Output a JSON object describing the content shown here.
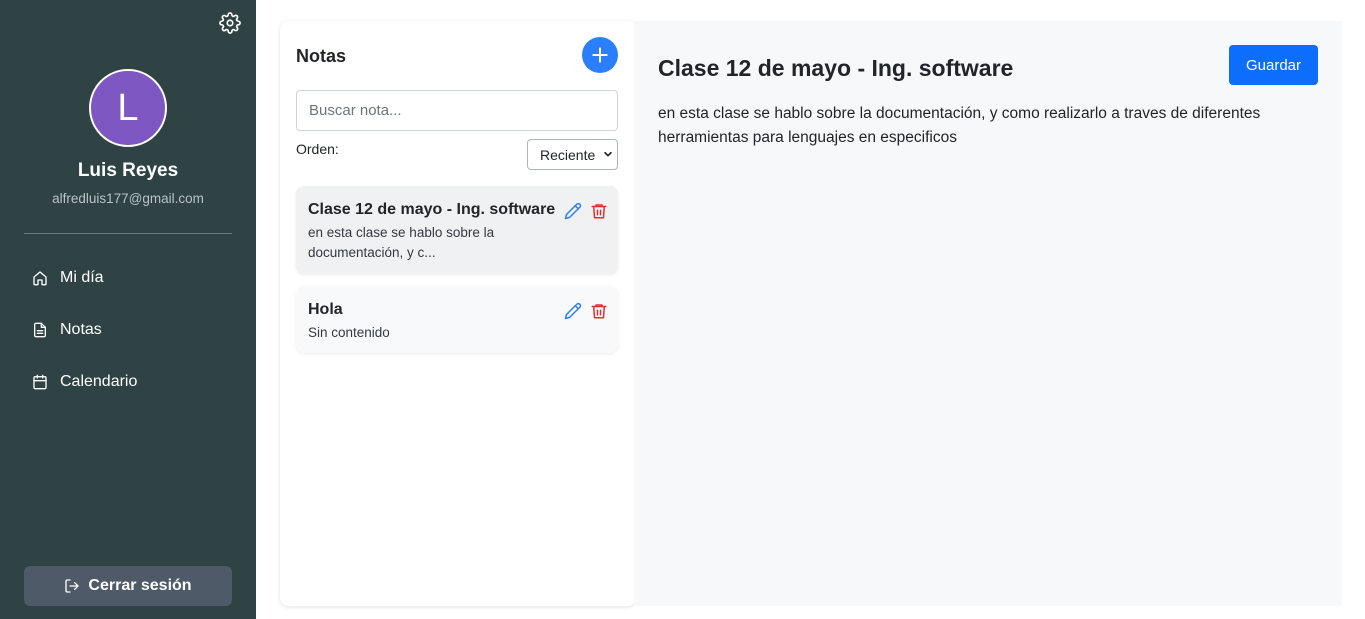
{
  "sidebar": {
    "avatar_letter": "L",
    "user_name": "Luis Reyes",
    "user_email": "alfredluis177@gmail.com",
    "nav": [
      {
        "label": "Mi día",
        "icon": "home-icon"
      },
      {
        "label": "Notas",
        "icon": "file-icon"
      },
      {
        "label": "Calendario",
        "icon": "calendar-icon"
      }
    ],
    "logout_label": "Cerrar sesión"
  },
  "notes_panel": {
    "title": "Notas",
    "search_placeholder": "Buscar nota...",
    "order_label": "Orden:",
    "order_value": "Reciente",
    "notes": [
      {
        "title": "Clase 12 de mayo - Ing. software",
        "preview": "en esta clase se hablo sobre la documentación, y c..."
      },
      {
        "title": "Hola",
        "preview": "Sin contenido"
      }
    ]
  },
  "editor": {
    "title": "Clase 12 de mayo - Ing. software",
    "save_label": "Guardar",
    "body": "en esta clase se hablo sobre la documentación, y como realizarlo a traves de diferentes herramientas para lenguajes en especificos"
  },
  "colors": {
    "sidebar_bg": "#2f4244",
    "avatar_bg": "#7e57c2",
    "accent": "#0d6efd",
    "edit_icon": "#2b7fff",
    "delete_icon": "#e03131"
  }
}
